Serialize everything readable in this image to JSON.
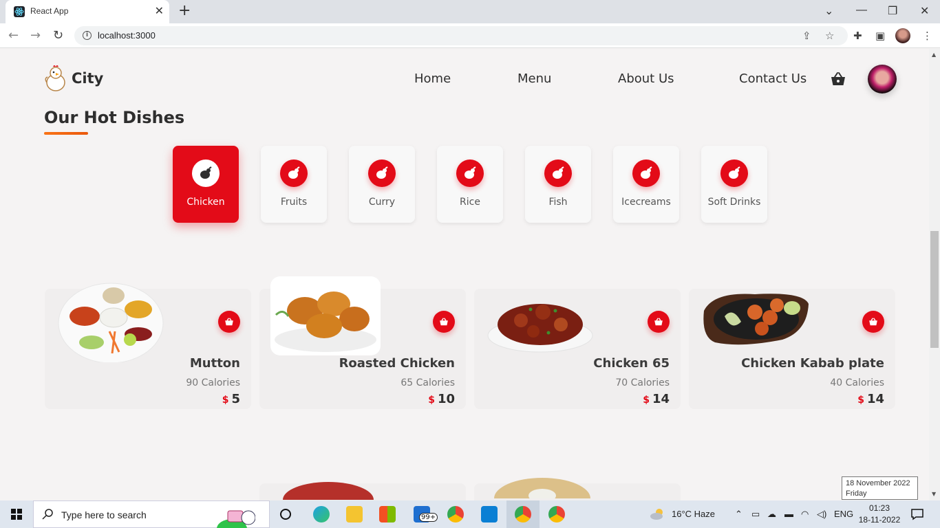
{
  "browser": {
    "tab_title": "React App",
    "tab_close": "✕",
    "new_tab": "+",
    "url": "localhost:3000"
  },
  "header": {
    "brand": "City",
    "nav": [
      "Home",
      "Menu",
      "About Us",
      "Contact Us"
    ]
  },
  "section": {
    "title": "Our Hot Dishes"
  },
  "categories": [
    {
      "label": "Chicken",
      "active": true
    },
    {
      "label": "Fruits",
      "active": false
    },
    {
      "label": "Curry",
      "active": false
    },
    {
      "label": "Rice",
      "active": false
    },
    {
      "label": "Fish",
      "active": false
    },
    {
      "label": "Icecreams",
      "active": false
    },
    {
      "label": "Soft Drinks",
      "active": false
    }
  ],
  "dishes": [
    {
      "name": "Mutton",
      "calories": "90 Calories",
      "currency": "$",
      "price": "5"
    },
    {
      "name": "Roasted Chicken",
      "calories": "65 Calories",
      "currency": "$",
      "price": "10"
    },
    {
      "name": "Chicken 65",
      "calories": "70 Calories",
      "currency": "$",
      "price": "14"
    },
    {
      "name": "Chicken Kabab plate",
      "calories": "40 Calories",
      "currency": "$",
      "price": "14"
    }
  ],
  "taskbar": {
    "search_placeholder": "Type here to search",
    "badge": "99+",
    "weather": "16°C  Haze",
    "language": "ENG",
    "time": "01:23",
    "date": "18-11-2022",
    "tooltip_date": "18 November 2022",
    "tooltip_day": "Friday"
  },
  "colors": {
    "accent": "#e30b18",
    "underline": "#f97316",
    "page_bg": "#f5f3f3"
  }
}
